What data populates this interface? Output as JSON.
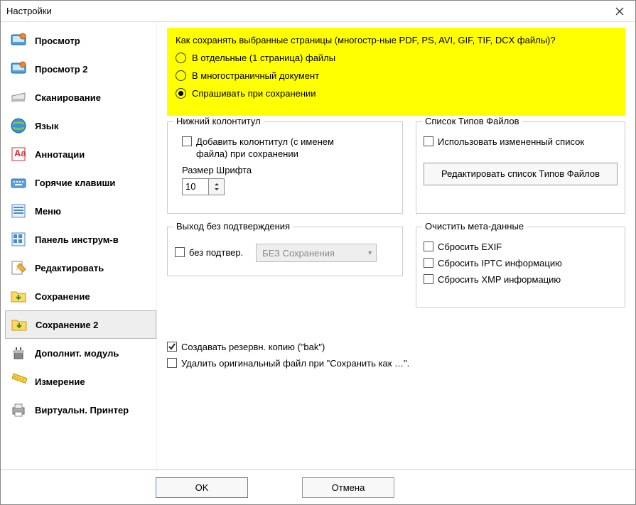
{
  "window": {
    "title": "Настройки"
  },
  "sidebar": {
    "items": [
      {
        "label": "Просмотр"
      },
      {
        "label": "Просмотр 2"
      },
      {
        "label": "Сканирование"
      },
      {
        "label": "Язык"
      },
      {
        "label": "Аннотации"
      },
      {
        "label": "Горячие клавиши"
      },
      {
        "label": "Меню"
      },
      {
        "label": "Панель инструм-в"
      },
      {
        "label": "Редактировать"
      },
      {
        "label": "Сохранение"
      },
      {
        "label": "Сохранение 2"
      },
      {
        "label": "Дополнит. модуль"
      },
      {
        "label": "Измерение"
      },
      {
        "label": "Виртуальн. Принтер"
      }
    ],
    "selected_index": 10
  },
  "main": {
    "multipage": {
      "question": "Как сохранять выбранные страницы (многостр-ные PDF, PS, AVI, GIF, TIF, DCX файлы)?",
      "options": [
        "В отдельные (1 страница) файлы",
        "В многостраничный документ",
        "Спрашивать при сохранении"
      ],
      "selected": 2
    },
    "footer_group": {
      "title": "Нижний колонтитул",
      "add_footer_label": "Добавить колонтитул (с именем файла) при сохранении",
      "add_footer_checked": false,
      "font_size_label": "Размер Шрифта",
      "font_size_value": "10"
    },
    "filetypes_group": {
      "title": "Список Типов Файлов",
      "use_modified_label": "Использовать измененный список",
      "use_modified_checked": false,
      "edit_button": "Редактировать список Типов Файлов"
    },
    "exit_group": {
      "title": "Выход без подтверждения",
      "no_confirm_label": "без подтвер.",
      "no_confirm_checked": false,
      "combo_value": "БЕЗ Сохранения"
    },
    "meta_group": {
      "title": "Очистить мета-данные",
      "reset_exif_label": "Сбросить EXIF",
      "reset_exif_checked": false,
      "reset_iptc_label": "Сбросить IPTC информацию",
      "reset_iptc_checked": false,
      "reset_xmp_label": "Сбросить XMP информацию",
      "reset_xmp_checked": false
    },
    "bottom": {
      "create_backup_label": "Создавать резервн. копию (\"bak\")",
      "create_backup_checked": true,
      "delete_original_label": "Удалить оригинальный файл при \"Сохранить как …\".",
      "delete_original_checked": false
    }
  },
  "buttons": {
    "ok": "OK",
    "cancel": "Отмена"
  }
}
